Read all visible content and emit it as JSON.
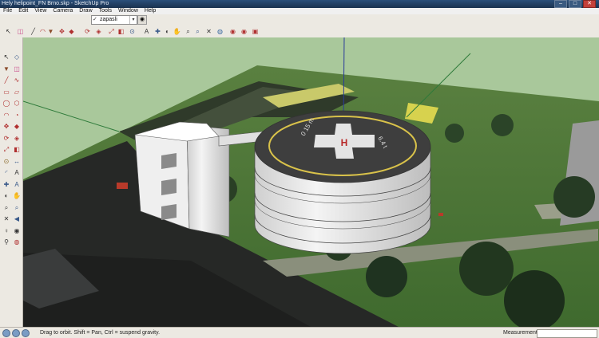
{
  "window": {
    "title": "Hely helipoint_FN Brno.skp - SketchUp Pro",
    "buttons": [
      "–",
      "□",
      "✕"
    ]
  },
  "menu": [
    "File",
    "Edit",
    "View",
    "Camera",
    "Draw",
    "Tools",
    "Window",
    "Help"
  ],
  "layers": {
    "current": "zapasli",
    "check": "✓",
    "arrow": "▾",
    "manager_icon": "◉"
  },
  "toolbar_icons": [
    {
      "name": "select-icon",
      "glyph": "↖",
      "color": "#222222"
    },
    {
      "name": "eraser-icon",
      "glyph": "◫",
      "color": "#c94a8a"
    },
    {
      "name": "line-icon",
      "glyph": "╱",
      "color": "#333333"
    },
    {
      "name": "arc-icon",
      "glyph": "◠",
      "color": "#b03030"
    },
    {
      "name": "paint-bucket-icon",
      "glyph": "▼",
      "color": "#8a4a2a"
    },
    {
      "name": "move-icon",
      "glyph": "✥",
      "color": "#b03030"
    },
    {
      "name": "push-pull-icon",
      "glyph": "◆",
      "color": "#b03030"
    },
    {
      "name": "rotate-icon",
      "glyph": "⟳",
      "color": "#b03030"
    },
    {
      "name": "follow-me-icon",
      "glyph": "◈",
      "color": "#b03030"
    },
    {
      "name": "scale-icon",
      "glyph": "⤢",
      "color": "#b03030"
    },
    {
      "name": "offset-icon",
      "glyph": "◧",
      "color": "#b03030"
    },
    {
      "name": "tape-measure-icon",
      "glyph": "⊙",
      "color": "#3a5a8a"
    },
    {
      "name": "text-icon",
      "glyph": "A",
      "color": "#333333"
    },
    {
      "name": "axes-icon",
      "glyph": "✚",
      "color": "#3a5a8a"
    },
    {
      "name": "orbit-icon",
      "glyph": "◐",
      "color": "#3a3a3a"
    },
    {
      "name": "pan-icon",
      "glyph": "✋",
      "color": "#8a5a2a"
    },
    {
      "name": "zoom-icon",
      "glyph": "⌕",
      "color": "#333333"
    },
    {
      "name": "zoom-window-icon",
      "glyph": "⌕",
      "color": "#3a5a8a"
    },
    {
      "name": "zoom-extents-icon",
      "glyph": "✕",
      "color": "#333333"
    },
    {
      "name": "google-earth-icon",
      "glyph": "◍",
      "color": "#3a6aa0"
    },
    {
      "name": "warehouse-icon",
      "glyph": "◉",
      "color": "#b03030"
    },
    {
      "name": "share-model-icon",
      "glyph": "◉",
      "color": "#b03030"
    },
    {
      "name": "components-icon",
      "glyph": "▣",
      "color": "#b03030"
    }
  ],
  "left_toolbar_icons": [
    {
      "name": "select-icon",
      "glyph": "↖",
      "color": "#222222"
    },
    {
      "name": "make-component-icon",
      "glyph": "◇",
      "color": "#3a5a8a"
    },
    {
      "name": "paint-bucket-icon",
      "glyph": "▼",
      "color": "#8a4a2a"
    },
    {
      "name": "eraser-icon",
      "glyph": "◫",
      "color": "#c94a8a"
    },
    {
      "name": "line-icon",
      "glyph": "╱",
      "color": "#b03030"
    },
    {
      "name": "freehand-icon",
      "glyph": "∿",
      "color": "#b03030"
    },
    {
      "name": "rectangle-icon",
      "glyph": "▭",
      "color": "#b03030"
    },
    {
      "name": "rotated-rectangle-icon",
      "glyph": "▱",
      "color": "#b03030"
    },
    {
      "name": "circle-icon",
      "glyph": "◯",
      "color": "#b03030"
    },
    {
      "name": "polygon-icon",
      "glyph": "⬡",
      "color": "#b03030"
    },
    {
      "name": "arc-icon",
      "glyph": "◠",
      "color": "#b03030"
    },
    {
      "name": "pie-icon",
      "glyph": "◔",
      "color": "#b03030"
    },
    {
      "name": "move-icon",
      "glyph": "✥",
      "color": "#b03030"
    },
    {
      "name": "push-pull-icon",
      "glyph": "◆",
      "color": "#b03030"
    },
    {
      "name": "rotate-icon",
      "glyph": "⟳",
      "color": "#b03030"
    },
    {
      "name": "follow-me-icon",
      "glyph": "◈",
      "color": "#b03030"
    },
    {
      "name": "scale-icon",
      "glyph": "⤢",
      "color": "#b03030"
    },
    {
      "name": "offset-icon",
      "glyph": "◧",
      "color": "#b03030"
    },
    {
      "name": "tape-measure-icon",
      "glyph": "⊙",
      "color": "#8a6a2a"
    },
    {
      "name": "dimension-icon",
      "glyph": "↔",
      "color": "#3a5a8a"
    },
    {
      "name": "protractor-icon",
      "glyph": "◜",
      "color": "#3a5a8a"
    },
    {
      "name": "text-icon",
      "glyph": "A",
      "color": "#333333"
    },
    {
      "name": "axes-icon",
      "glyph": "✚",
      "color": "#3a5a8a"
    },
    {
      "name": "3d-text-icon",
      "glyph": "A",
      "color": "#3a5a8a"
    },
    {
      "name": "orbit-icon",
      "glyph": "◐",
      "color": "#3a3a3a"
    },
    {
      "name": "pan-icon",
      "glyph": "✋",
      "color": "#8a5a2a"
    },
    {
      "name": "zoom-icon",
      "glyph": "⌕",
      "color": "#333333"
    },
    {
      "name": "zoom-window-icon",
      "glyph": "⌕",
      "color": "#3a5a8a"
    },
    {
      "name": "zoom-extents-icon",
      "glyph": "✕",
      "color": "#333333"
    },
    {
      "name": "previous-view-icon",
      "glyph": "◀",
      "color": "#3a5a8a"
    },
    {
      "name": "position-camera-icon",
      "glyph": "♀",
      "color": "#333333"
    },
    {
      "name": "look-around-icon",
      "glyph": "◉",
      "color": "#333333"
    },
    {
      "name": "walk-icon",
      "glyph": "⚲",
      "color": "#333333"
    },
    {
      "name": "section-plane-icon",
      "glyph": "◍",
      "color": "#b03030"
    }
  ],
  "helipad": {
    "marking_left": "0 15 m",
    "marking_right": "6.4 t",
    "letter": "H"
  },
  "status": {
    "text": "Drag to orbit. Shift = Pan, Ctrl = suspend gravity.",
    "measurements_label": "Measurements",
    "measurements_value": ""
  },
  "colors": {
    "sky": "#a9c89b",
    "grass": "#4f7a3a",
    "asphalt": "#2a2a2a",
    "helipad_deck": "#4a4a4a",
    "helipad_ring": "#d9c24a",
    "cross": "#e8e8e8",
    "h_letter": "#b82828",
    "building": "#f2f2f2",
    "axis_blue": "#2a3a9a"
  }
}
